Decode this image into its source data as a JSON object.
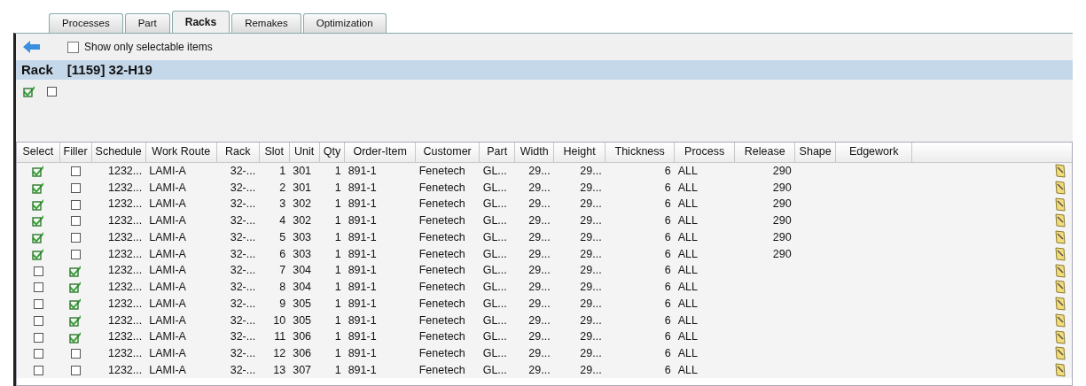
{
  "tabs": [
    {
      "label": "Processes",
      "selected": false
    },
    {
      "label": "Part",
      "selected": false
    },
    {
      "label": "Racks",
      "selected": true
    },
    {
      "label": "Remakes",
      "selected": false
    },
    {
      "label": "Optimization",
      "selected": false
    }
  ],
  "toolbar": {
    "show_only_selectable": {
      "label": "Show only selectable items",
      "checked": false
    }
  },
  "rack_header": {
    "label": "Rack",
    "value": "[1159] 32-H19"
  },
  "bulk": {
    "select_all": {
      "checked": true
    },
    "clear_all": {
      "checked": false
    }
  },
  "table": {
    "checkbox_columns": [
      "Select",
      "Filler"
    ],
    "columns": [
      "Schedule",
      "Work Route",
      "Rack",
      "Slot",
      "Unit",
      "Qty",
      "Order-Item",
      "Customer",
      "Part",
      "Width",
      "Height",
      "Thickness",
      "Process",
      "Release",
      "Shape",
      "Edgework"
    ],
    "rows": [
      {
        "select": true,
        "filler": false,
        "cells": [
          "1232...",
          "LAMI-A",
          "32-...",
          "1",
          "301",
          "1",
          "891-1",
          "Fenetech",
          "GL...",
          "29...",
          "29...",
          "6",
          "ALL",
          "290",
          "",
          ""
        ]
      },
      {
        "select": true,
        "filler": false,
        "cells": [
          "1232...",
          "LAMI-A",
          "32-...",
          "2",
          "301",
          "1",
          "891-1",
          "Fenetech",
          "GL...",
          "29...",
          "29...",
          "6",
          "ALL",
          "290",
          "",
          ""
        ]
      },
      {
        "select": true,
        "filler": false,
        "cells": [
          "1232...",
          "LAMI-A",
          "32-...",
          "3",
          "302",
          "1",
          "891-1",
          "Fenetech",
          "GL...",
          "29...",
          "29...",
          "6",
          "ALL",
          "290",
          "",
          ""
        ]
      },
      {
        "select": true,
        "filler": false,
        "cells": [
          "1232...",
          "LAMI-A",
          "32-...",
          "4",
          "302",
          "1",
          "891-1",
          "Fenetech",
          "GL...",
          "29...",
          "29...",
          "6",
          "ALL",
          "290",
          "",
          ""
        ]
      },
      {
        "select": true,
        "filler": false,
        "cells": [
          "1232...",
          "LAMI-A",
          "32-...",
          "5",
          "303",
          "1",
          "891-1",
          "Fenetech",
          "GL...",
          "29...",
          "29...",
          "6",
          "ALL",
          "290",
          "",
          ""
        ]
      },
      {
        "select": true,
        "filler": false,
        "cells": [
          "1232...",
          "LAMI-A",
          "32-...",
          "6",
          "303",
          "1",
          "891-1",
          "Fenetech",
          "GL...",
          "29...",
          "29...",
          "6",
          "ALL",
          "290",
          "",
          ""
        ]
      },
      {
        "select": false,
        "filler": true,
        "cells": [
          "1232...",
          "LAMI-A",
          "32-...",
          "7",
          "304",
          "1",
          "891-1",
          "Fenetech",
          "GL...",
          "29...",
          "29...",
          "6",
          "ALL",
          "",
          "",
          ""
        ]
      },
      {
        "select": false,
        "filler": true,
        "cells": [
          "1232...",
          "LAMI-A",
          "32-...",
          "8",
          "304",
          "1",
          "891-1",
          "Fenetech",
          "GL...",
          "29...",
          "29...",
          "6",
          "ALL",
          "",
          "",
          ""
        ]
      },
      {
        "select": false,
        "filler": true,
        "cells": [
          "1232...",
          "LAMI-A",
          "32-...",
          "9",
          "305",
          "1",
          "891-1",
          "Fenetech",
          "GL...",
          "29...",
          "29...",
          "6",
          "ALL",
          "",
          "",
          ""
        ]
      },
      {
        "select": false,
        "filler": true,
        "cells": [
          "1232...",
          "LAMI-A",
          "32-...",
          "10",
          "305",
          "1",
          "891-1",
          "Fenetech",
          "GL...",
          "29...",
          "29...",
          "6",
          "ALL",
          "",
          "",
          ""
        ]
      },
      {
        "select": false,
        "filler": true,
        "cells": [
          "1232...",
          "LAMI-A",
          "32-...",
          "11",
          "306",
          "1",
          "891-1",
          "Fenetech",
          "GL...",
          "29...",
          "29...",
          "6",
          "ALL",
          "",
          "",
          ""
        ]
      },
      {
        "select": false,
        "filler": false,
        "cells": [
          "1232...",
          "LAMI-A",
          "32-...",
          "12",
          "306",
          "1",
          "891-1",
          "Fenetech",
          "GL...",
          "29...",
          "29...",
          "6",
          "ALL",
          "",
          "",
          ""
        ]
      },
      {
        "select": false,
        "filler": false,
        "cells": [
          "1232...",
          "LAMI-A",
          "32-...",
          "13",
          "307",
          "1",
          "891-1",
          "Fenetech",
          "GL...",
          "29...",
          "29...",
          "6",
          "ALL",
          "",
          "",
          ""
        ]
      }
    ]
  }
}
